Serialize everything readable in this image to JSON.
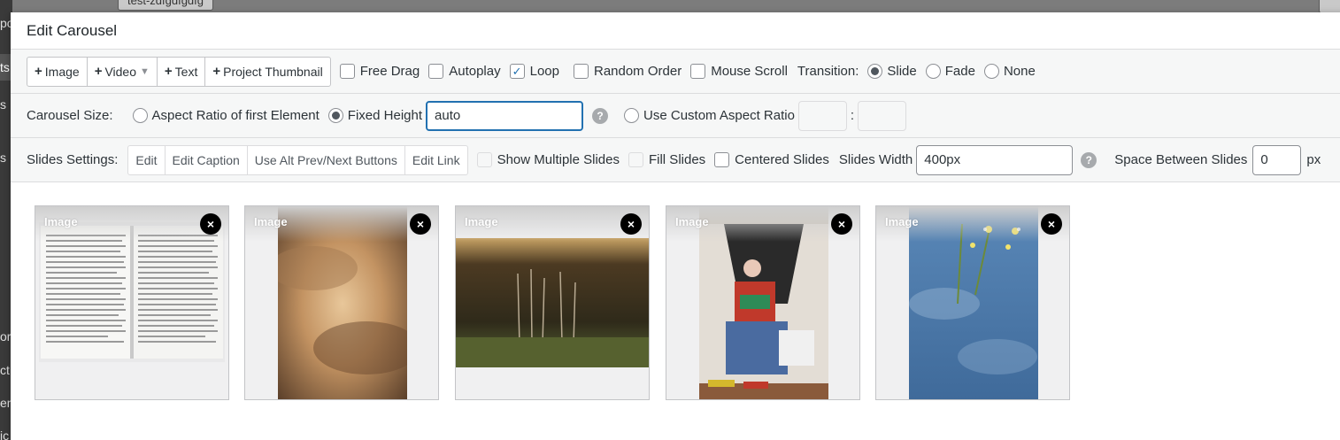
{
  "background": {
    "sidebar_fragments": [
      "po",
      "ts",
      "s",
      "or",
      "ct",
      "en",
      "ic"
    ],
    "top_button": "test-zdfgdfgdfg"
  },
  "modal": {
    "title": "Edit Carousel"
  },
  "toolbar": {
    "add_buttons": [
      {
        "label": "Image",
        "has_caret": false
      },
      {
        "label": "Video",
        "has_caret": true
      },
      {
        "label": "Text",
        "has_caret": false
      },
      {
        "label": "Project Thumbnail",
        "has_caret": false
      }
    ],
    "checkboxes": [
      {
        "label": "Free Drag",
        "checked": false
      },
      {
        "label": "Autoplay",
        "checked": false
      },
      {
        "label": "Loop",
        "checked": true
      },
      {
        "label": "Random Order",
        "checked": false
      },
      {
        "label": "Mouse Scroll",
        "checked": false
      }
    ],
    "transition_label": "Transition:",
    "transitions": [
      {
        "label": "Slide",
        "selected": true
      },
      {
        "label": "Fade",
        "selected": false
      },
      {
        "label": "None",
        "selected": false
      }
    ]
  },
  "size": {
    "label": "Carousel Size:",
    "option_aspect": "Aspect Ratio of first Element",
    "option_fixed": "Fixed Height",
    "selected": "Fixed Height",
    "fixed_height_value": "auto",
    "option_custom": "Use Custom Aspect Ratio",
    "ratio_separator": ":",
    "ratio_w": "",
    "ratio_h": "",
    "help": "?"
  },
  "slides_settings": {
    "label": "Slides Settings:",
    "buttons": [
      "Edit",
      "Edit Caption",
      "Use Alt Prev/Next Buttons",
      "Edit Link"
    ],
    "show_multiple": "Show Multiple Slides",
    "fill_slides": "Fill Slides",
    "centered": "Centered Slides",
    "width_label": "Slides Width",
    "width_value": "400px",
    "help": "?",
    "space_label": "Space Between Slides",
    "space_value": "0",
    "space_unit": "px"
  },
  "slides": [
    {
      "tag": "Image",
      "close": "×",
      "art": "book-spread"
    },
    {
      "tag": "Image",
      "close": "×",
      "art": "sunset-clouds"
    },
    {
      "tag": "Image",
      "close": "×",
      "art": "forest-field"
    },
    {
      "tag": "Image",
      "close": "×",
      "art": "person-portrait"
    },
    {
      "tag": "Image",
      "close": "×",
      "art": "water-flowers"
    }
  ],
  "colors": {
    "accent": "#2271b1",
    "border": "#c3c4c7",
    "toolbar_bg": "#f6f7f7"
  }
}
